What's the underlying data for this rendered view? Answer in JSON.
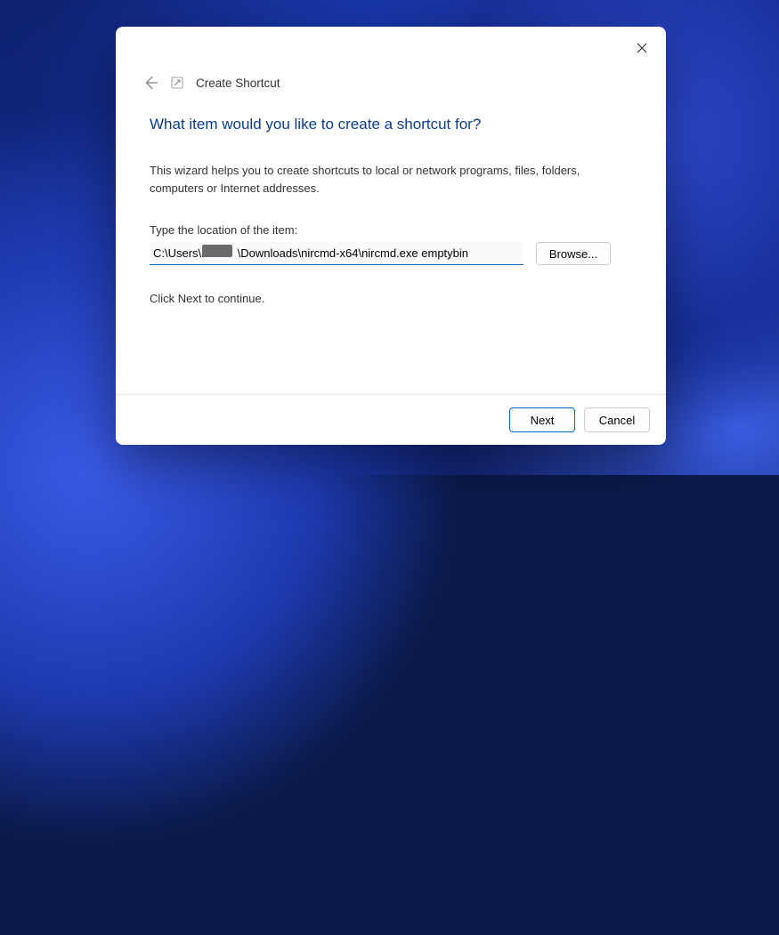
{
  "header": {
    "title": "Create Shortcut"
  },
  "main": {
    "headline": "What item would you like to create a shortcut for?",
    "description": "This wizard helps you to create shortcuts to local or network programs, files, folders, computers or Internet addresses.",
    "location_label": "Type the location of the item:",
    "location_value": "C:\\Users\\r          \\Downloads\\nircmd-x64\\nircmd.exe emptybin",
    "browse_label": "Browse...",
    "continue_hint": "Click Next to continue."
  },
  "footer": {
    "next_label": "Next",
    "cancel_label": "Cancel"
  },
  "colors": {
    "accent": "#0067c0",
    "headline": "#0b3d91"
  }
}
